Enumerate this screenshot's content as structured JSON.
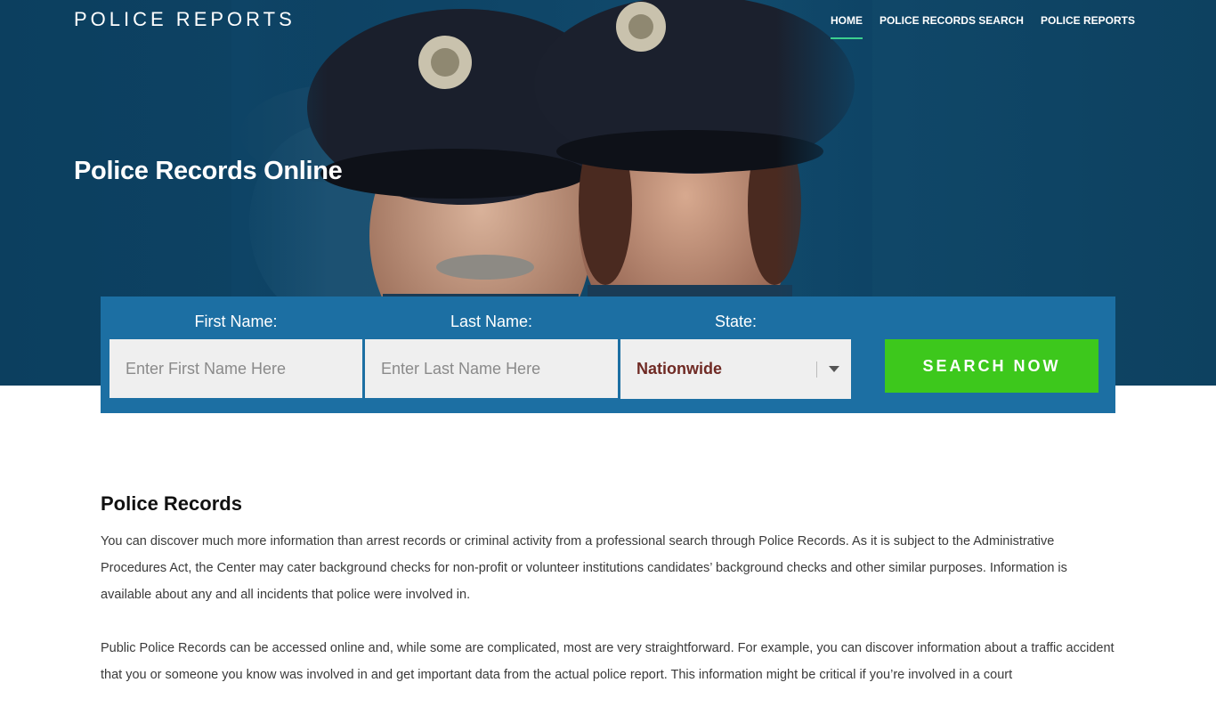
{
  "header": {
    "brand": "POLICE REPORTS",
    "nav": [
      "HOME",
      "POLICE RECORDS SEARCH",
      "POLICE REPORTS"
    ]
  },
  "hero": {
    "title": "Police Records Online"
  },
  "search": {
    "first_label": "First Name:",
    "first_placeholder": "Enter First Name Here",
    "last_label": "Last Name:",
    "last_placeholder": "Enter Last Name Here",
    "state_label": "State:",
    "state_value": "Nationwide",
    "button_label": "SEARCH NOW"
  },
  "content": {
    "heading": "Police Records",
    "paragraphs": [
      "You can discover much more information than arrest records or criminal activity from a professional search through Police Records. As it is subject to the Administrative Procedures Act, the Center may cater background checks for non-profit or volunteer institutions candidates’ background checks and other similar purposes. Information is available about any and all incidents that police were involved in.",
      "Public Police Records can be accessed online and, while some are complicated, most are very straightforward. For example, you can discover information about a traffic accident that you or someone you know was involved in and get important data from the actual police report. This information might be critical if you’re involved in a court"
    ]
  },
  "colors": {
    "hero_bg": "#0e4466",
    "search_panel": "#1c6fa3",
    "button": "#3dc81c",
    "nav_active_underline": "#3ccf8e",
    "state_text": "#6f2a24"
  },
  "icons": [
    "chevron-down-icon"
  ]
}
